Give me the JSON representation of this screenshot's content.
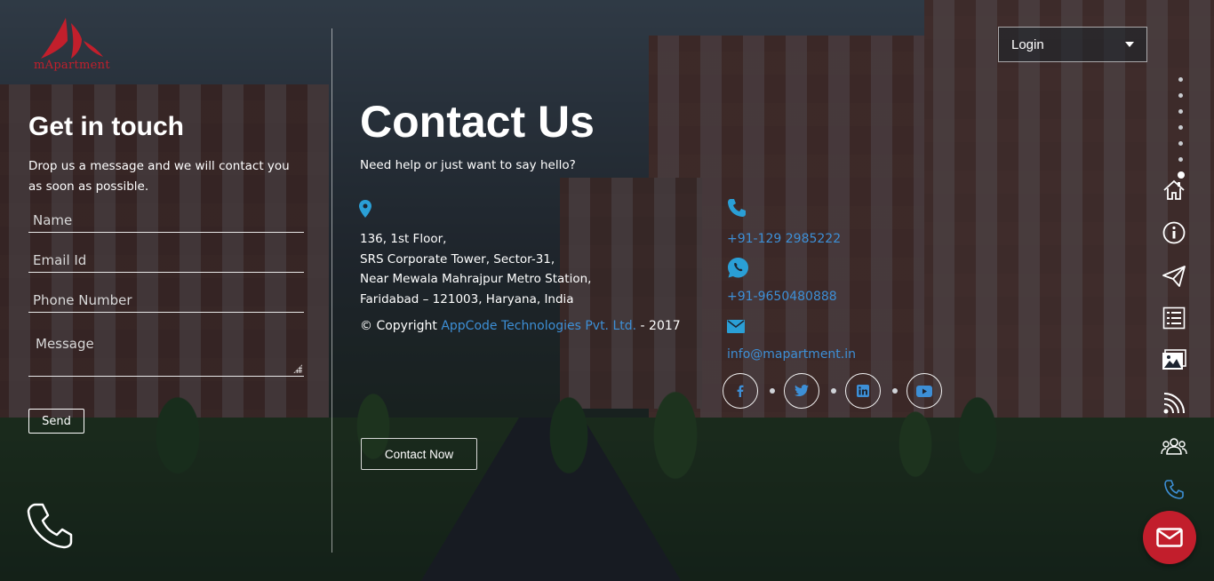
{
  "brand": {
    "logo_text": "mApartment",
    "logo_color": "#c21f2c"
  },
  "form": {
    "title": "Get in touch",
    "description": "Drop us a message and we will contact you as soon as possible.",
    "name_placeholder": "Name",
    "email_placeholder": "Email Id",
    "phone_placeholder": "Phone Number",
    "message_placeholder": "Message",
    "send_label": "Send"
  },
  "contact": {
    "title": "Contact Us",
    "subtitle": "Need help or just want to say hello?",
    "address": [
      "136, 1st Floor,",
      "SRS Corporate Tower, Sector-31,",
      "Near Mewala Mahrajpur Metro Station,",
      "Faridabad – 121003, Haryana, India"
    ],
    "copyright_prefix": "© Copyright",
    "company_link": "AppCode Technologies Pvt. Ltd.",
    "copyright_suffix": "- 2017",
    "contact_button": "Contact Now",
    "phone": "+91-129 2985222",
    "whatsapp": "+91-9650480888",
    "email": "info@mapartment.in",
    "link_color": "#3d8fd6"
  },
  "social": [
    "facebook-icon",
    "twitter-icon",
    "linkedin-icon",
    "youtube-icon"
  ],
  "header": {
    "login_label": "Login"
  },
  "side_nav": [
    "home-icon",
    "info-icon",
    "send-icon",
    "list-icon",
    "gallery-icon",
    "rss-icon",
    "users-icon",
    "phone-icon"
  ],
  "pager": {
    "count": 7,
    "active_index": 6
  },
  "fab": {
    "icon": "mail-icon",
    "color": "#c21e2c"
  }
}
